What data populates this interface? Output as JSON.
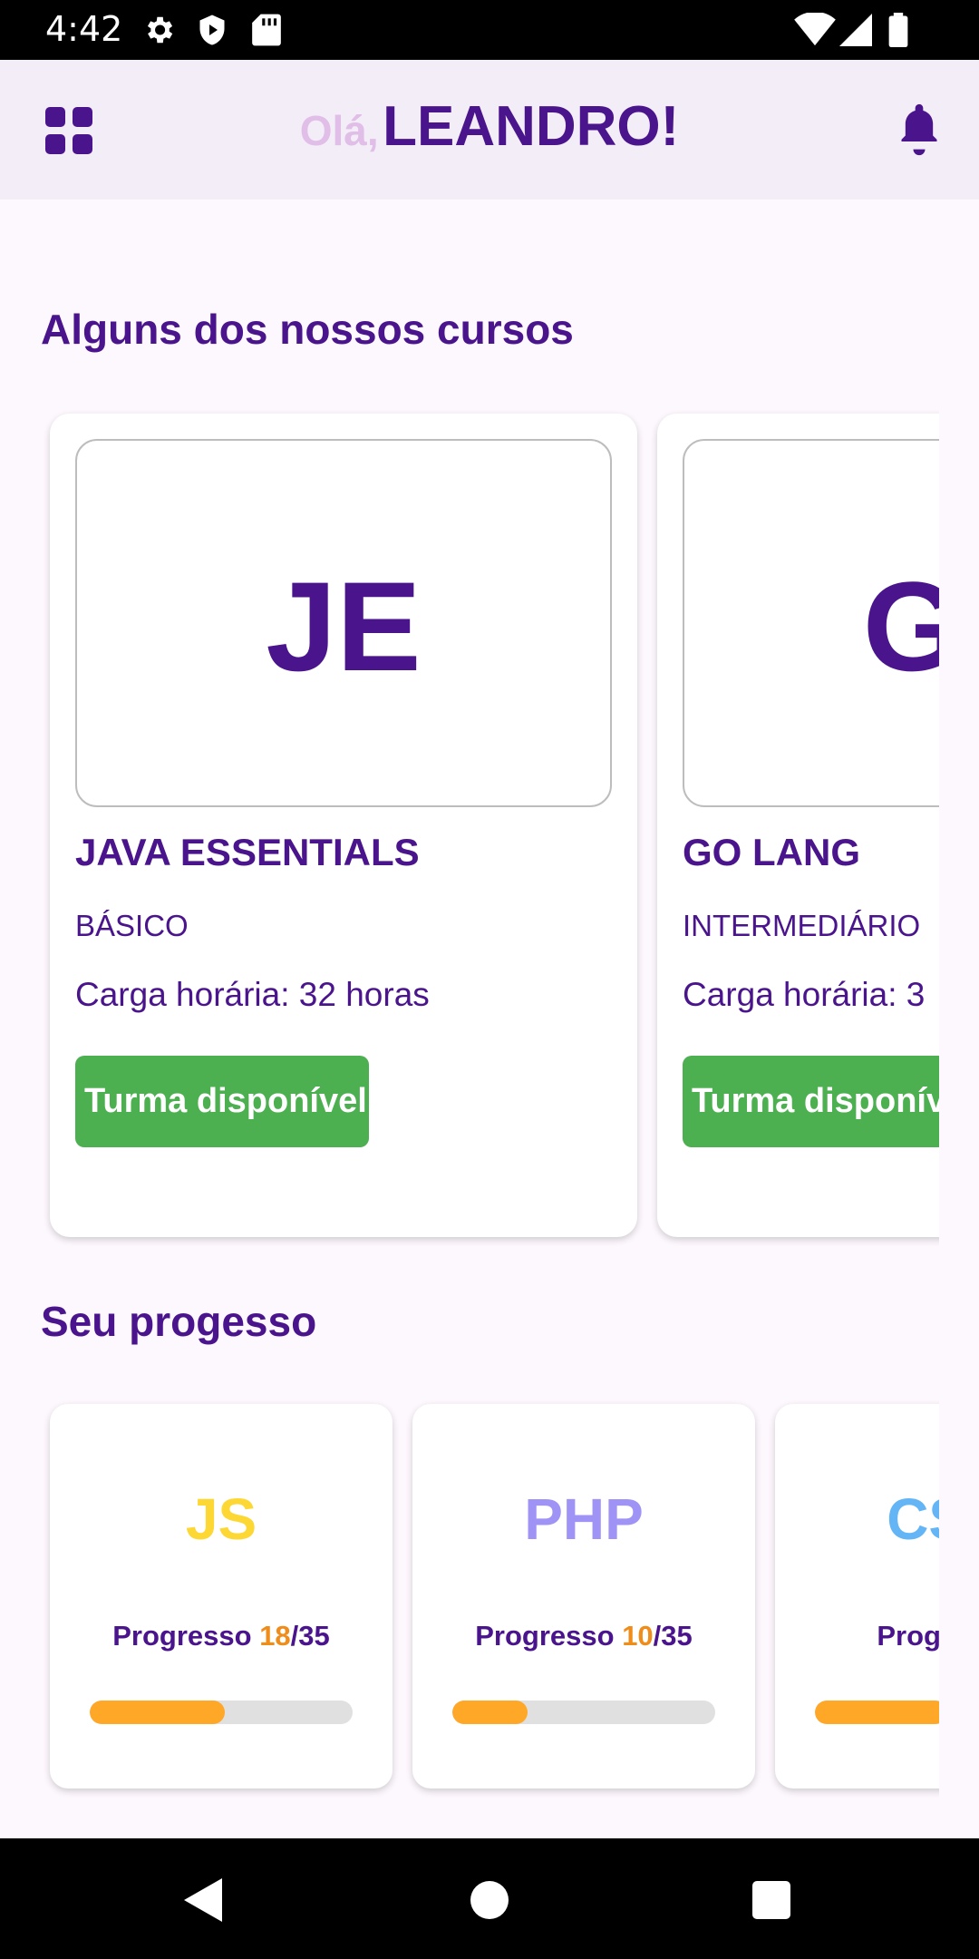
{
  "status_bar": {
    "time": "4:42",
    "icons": [
      "settings-icon",
      "play-protect-icon",
      "sd-card-icon",
      "wifi-icon",
      "signal-icon",
      "battery-icon"
    ]
  },
  "app_bar": {
    "greeting": "Olá,",
    "user_name": "LEANDRO!",
    "menu_icon": "grid-menu-icon",
    "notification_icon": "bell-icon"
  },
  "courses_section": {
    "title": "Alguns dos nossos cursos",
    "courses": [
      {
        "initials": "JE",
        "name": "JAVA ESSENTIALS",
        "level": "BÁSICO",
        "hours_text": "Carga horária: 32 horas",
        "button": "Turma disponível"
      },
      {
        "initials": "GL",
        "name": "GO LANG",
        "level": "INTERMEDIÁRIO",
        "hours_text": "Carga horária: 3",
        "button": "Turma disponível"
      }
    ]
  },
  "progress_section": {
    "title": "Seu progesso",
    "label": "Progresso",
    "items": [
      {
        "lang": "JS",
        "current": "18",
        "total": "/35",
        "fraction": 0.514,
        "color": "#fdd835"
      },
      {
        "lang": "PHP",
        "current": "10",
        "total": "/35",
        "fraction": 0.286,
        "color": "#9f93f5"
      },
      {
        "lang": "CSS",
        "current": "",
        "total": "",
        "fraction": 0.5,
        "color": "#64b5f6"
      }
    ]
  },
  "colors": {
    "primary": "#4a148c",
    "greeting_light": "#e1bee7",
    "available_button": "#4caf50",
    "progress_fill": "#ffa726",
    "progress_current": "#ef8c1a"
  },
  "nav_bar": {
    "icons": [
      "back-icon",
      "home-icon",
      "recents-icon"
    ]
  }
}
